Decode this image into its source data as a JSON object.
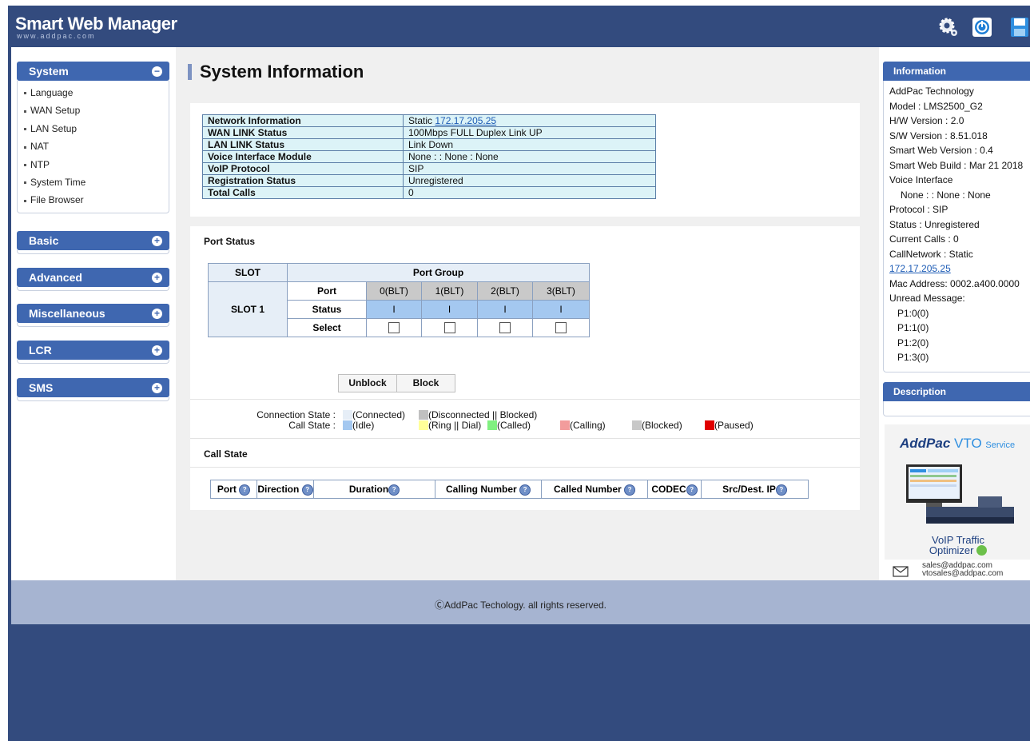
{
  "header": {
    "title": "Smart Web Manager",
    "subtitle": "www.addpac.com",
    "icons": [
      "gear-icon",
      "power-icon",
      "save-icon"
    ]
  },
  "nav": {
    "system": {
      "label": "System",
      "items": [
        "Language",
        "WAN Setup",
        "LAN Setup",
        "NAT",
        "NTP",
        "System Time",
        "File Browser"
      ]
    },
    "basic": {
      "label": "Basic"
    },
    "advanced": {
      "label": "Advanced"
    },
    "misc": {
      "label": "Miscellaneous"
    },
    "lcr": {
      "label": "LCR"
    },
    "sms": {
      "label": "SMS"
    }
  },
  "main": {
    "title": "System Information",
    "network": {
      "rows": [
        {
          "key": "Network Information",
          "value": "Static ",
          "link": "172.17.205.25"
        },
        {
          "key": "WAN LINK Status",
          "value": "100Mbps FULL Duplex Link UP"
        },
        {
          "key": "LAN LINK Status",
          "value": "Link Down"
        },
        {
          "key": "Voice Interface Module",
          "value": "None : : None : None"
        },
        {
          "key": "VoIP Protocol",
          "value": "SIP"
        },
        {
          "key": "Registration Status",
          "value": "Unregistered"
        },
        {
          "key": "Total Calls",
          "value": "0"
        }
      ]
    },
    "port_status": {
      "title": "Port Status",
      "slot_header": "SLOT",
      "group_header": "Port Group",
      "slot_label": "SLOT 1",
      "row_labels": [
        "Port",
        "Status",
        "Select"
      ],
      "ports": [
        "0(BLT)",
        "1(BLT)",
        "2(BLT)",
        "3(BLT)"
      ],
      "status": [
        "I",
        "I",
        "I",
        "I"
      ],
      "unblock": "Unblock",
      "block": "Block"
    },
    "legend": {
      "connection_label": "Connection State :",
      "call_label": "Call State :",
      "connected": "(Connected)",
      "disconnected": "(Disconnected || Blocked)",
      "idle": "(Idle)",
      "ring": "(Ring || Dial)",
      "called": "(Called)",
      "calling": "(Calling)",
      "blocked": "(Blocked)",
      "paused": "(Paused)",
      "colors": {
        "connected": "#e6eef7",
        "disconnected": "#c0c0c0",
        "idle": "#a4c8f0",
        "ring": "#ffff99",
        "called": "#80f080",
        "calling": "#f29c9c",
        "blocked": "#c8c8c8",
        "paused": "#e00000"
      }
    },
    "call_state": {
      "title": "Call State",
      "columns": [
        "Port",
        "Direction",
        "Duration",
        "Calling Number",
        "Called Number",
        "CODEC",
        "Src/Dest. IP"
      ]
    }
  },
  "info": {
    "title": "Information",
    "lines": [
      "AddPac Technology",
      "Model : LMS2500_G2",
      "H/W Version : 2.0",
      "S/W Version : 8.51.018",
      "Smart Web Version : 0.4",
      "Smart Web Build : Mar 21 2018",
      "Voice Interface",
      "None : : None : None",
      "Protocol : SIP",
      "Status : Unregistered",
      "Current Calls : 0",
      "CallNetwork : Static"
    ],
    "ip_link": "172.17.205.25",
    "lines2": [
      "Mac Address: 0002.a400.0000",
      "Unread Message:",
      "P1:0(0)",
      "P1:1(0)",
      "P1:2(0)",
      "P1:3(0)"
    ]
  },
  "description": {
    "title": "Description",
    "brand": "AddPac",
    "product": "VTO",
    "service": "Service",
    "tagline1": "VoIP Traffic",
    "tagline2": "Optimizer",
    "email1": "sales@addpac.com",
    "email2": "vtosales@addpac.com"
  },
  "footer": {
    "text": "ⒸAddPac Techology. all rights reserved."
  }
}
